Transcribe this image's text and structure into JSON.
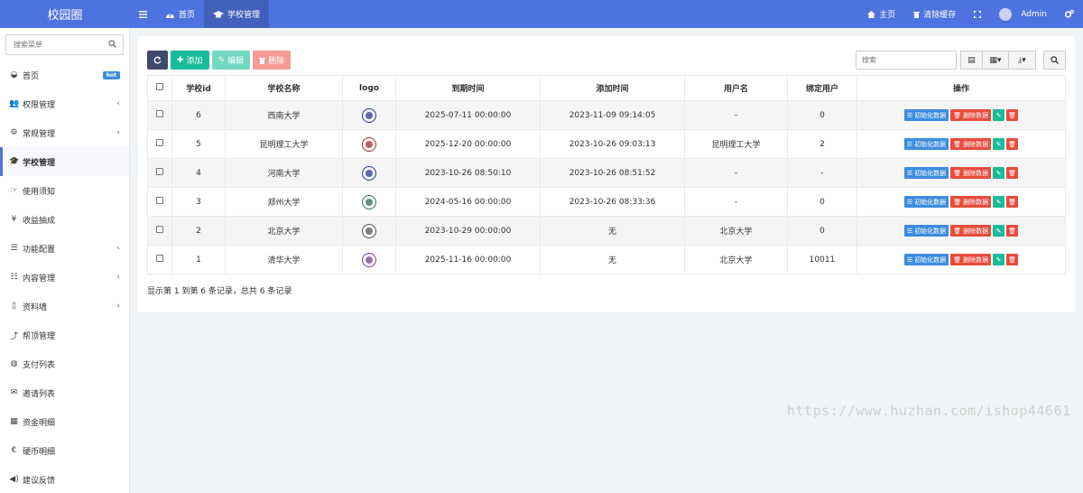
{
  "header": {
    "brand": "校园圈",
    "tabs": [
      {
        "label": "首页"
      },
      {
        "label": "学校管理"
      }
    ],
    "right": {
      "home": "主页",
      "clear_cache": "清除缓存",
      "user": "Admin"
    }
  },
  "sidebar": {
    "search_placeholder": "搜索菜单",
    "items": [
      {
        "label": "首页",
        "badge": "hot"
      },
      {
        "label": "权限管理"
      },
      {
        "label": "常规管理"
      },
      {
        "label": "学校管理"
      },
      {
        "label": "使用须知"
      },
      {
        "label": "收益抽成"
      },
      {
        "label": "功能配置"
      },
      {
        "label": "内容管理"
      },
      {
        "label": "资料墙"
      },
      {
        "label": "帮顶管理"
      },
      {
        "label": "支付列表"
      },
      {
        "label": "邀请列表"
      },
      {
        "label": "资金明细"
      },
      {
        "label": "硬币明细"
      },
      {
        "label": "建议反馈"
      }
    ]
  },
  "toolbar": {
    "add": "添加",
    "edit": "编辑",
    "delete": "删除",
    "search_placeholder": "搜索"
  },
  "table": {
    "headers": [
      "学校id",
      "学校名称",
      "logo",
      "到期时间",
      "添加时间",
      "用户名",
      "绑定用户",
      "操作"
    ],
    "action_labels": {
      "init": "初始化数据",
      "clear": "删除数据"
    },
    "rows": [
      {
        "id": "6",
        "name": "西南大学",
        "expire": "2025-07-11 00:00:00",
        "added": "2023-11-09 09:14:05",
        "username": "-",
        "bound": "0"
      },
      {
        "id": "5",
        "name": "昆明理工大学",
        "expire": "2025-12-20 00:00:00",
        "added": "2023-10-26 09:03:13",
        "username": "昆明理工大学",
        "bound": "2"
      },
      {
        "id": "4",
        "name": "河南大学",
        "expire": "2023-10-26 08:50:10",
        "added": "2023-10-26 08:51:52",
        "username": "-",
        "bound": "-"
      },
      {
        "id": "3",
        "name": "郑州大学",
        "expire": "2024-05-16 00:00:00",
        "added": "2023-10-26 08:33:36",
        "username": "-",
        "bound": "0"
      },
      {
        "id": "2",
        "name": "北京大学",
        "expire": "2023-10-29 00:00:00",
        "added": "无",
        "username": "北京大学",
        "bound": "0"
      },
      {
        "id": "1",
        "name": "清华大学",
        "expire": "2025-11-16 00:00:00",
        "added": "无",
        "username": "北京大学",
        "bound": "10011"
      }
    ]
  },
  "summary": "显示第 1 到第 6 条记录，总共 6 条记录",
  "watermark": "https://www.huzhan.com/ishop44661",
  "colors": {
    "header_bg": "#4e73df",
    "primary_green": "#18bc9c",
    "danger": "#e74c3c",
    "info": "#3c8dde",
    "logo_colors": [
      "#1f3f8f",
      "#a52a2a",
      "#1f3f8f",
      "#2e6b4f",
      "#555555",
      "#7a3e8c"
    ]
  }
}
